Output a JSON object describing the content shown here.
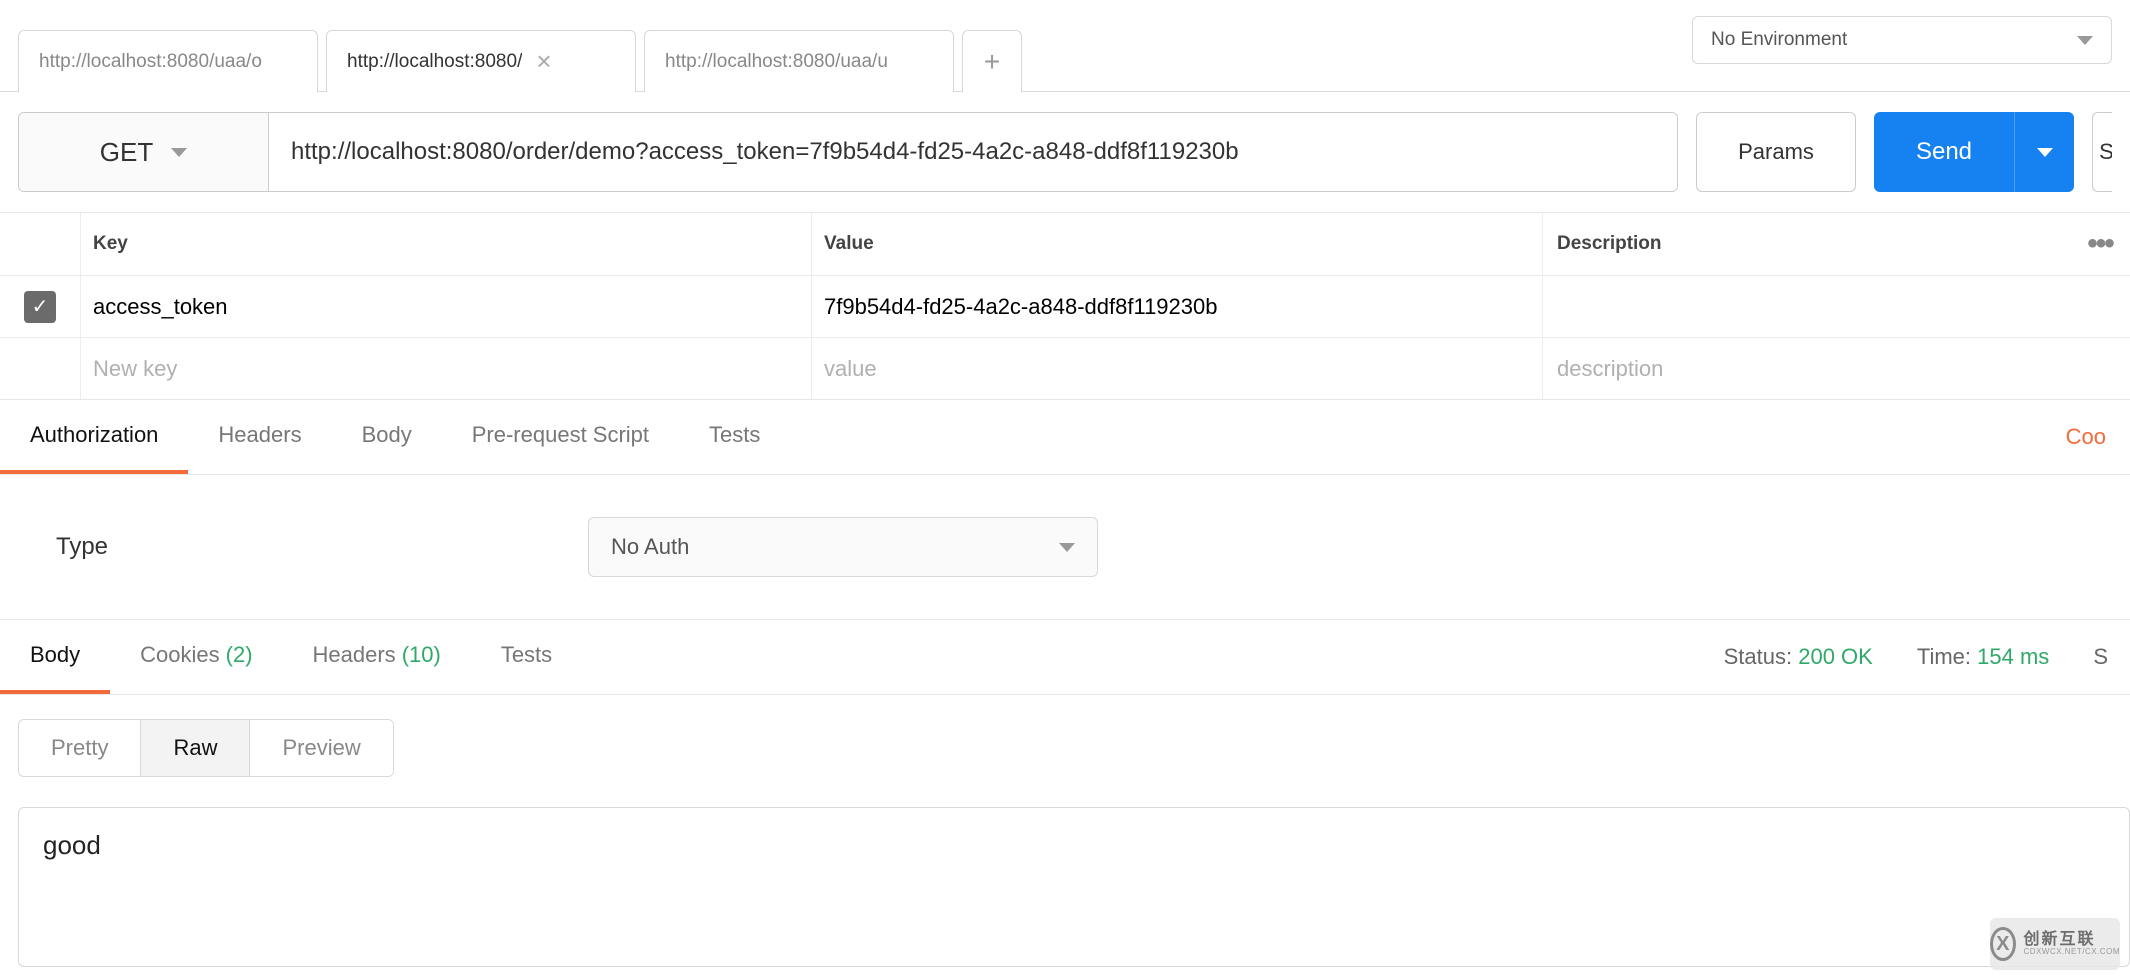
{
  "environment": {
    "label": "No Environment"
  },
  "tabs": [
    {
      "label": "http://localhost:8080/uaa/o",
      "active": false
    },
    {
      "label": "http://localhost:8080/",
      "active": true
    },
    {
      "label": "http://localhost:8080/uaa/u",
      "active": false
    }
  ],
  "request": {
    "method": "GET",
    "url": "http://localhost:8080/order/demo?access_token=7f9b54d4-fd25-4a2c-a848-ddf8f119230b",
    "params_label": "Params",
    "send_label": "Send",
    "save_fragment": "S"
  },
  "params_table": {
    "headers": {
      "key": "Key",
      "value": "Value",
      "description": "Description"
    },
    "rows": [
      {
        "enabled": true,
        "key": "access_token",
        "value": "7f9b54d4-fd25-4a2c-a848-ddf8f119230b",
        "description": ""
      }
    ],
    "placeholders": {
      "key": "New key",
      "value": "value",
      "description": "description"
    }
  },
  "request_tabs": {
    "items": [
      "Authorization",
      "Headers",
      "Body",
      "Pre-request Script",
      "Tests"
    ],
    "active": "Authorization",
    "right_link": "Coo"
  },
  "authorization": {
    "type_label": "Type",
    "selected": "No Auth"
  },
  "response_tabs": {
    "items": [
      {
        "label": "Body",
        "count": null,
        "active": true
      },
      {
        "label": "Cookies",
        "count": "(2)",
        "active": false
      },
      {
        "label": "Headers",
        "count": "(10)",
        "active": false
      },
      {
        "label": "Tests",
        "count": null,
        "active": false
      }
    ],
    "status": {
      "label": "Status:",
      "value": "200 OK"
    },
    "time": {
      "label": "Time:",
      "value": "154 ms"
    },
    "size_fragment": "S"
  },
  "view_toggle": {
    "items": [
      "Pretty",
      "Raw",
      "Preview"
    ],
    "active": "Raw"
  },
  "response_body": "good",
  "watermark": {
    "brand_cn": "创新互联",
    "brand_en": "CDXWCX.NET/CX.COM"
  }
}
